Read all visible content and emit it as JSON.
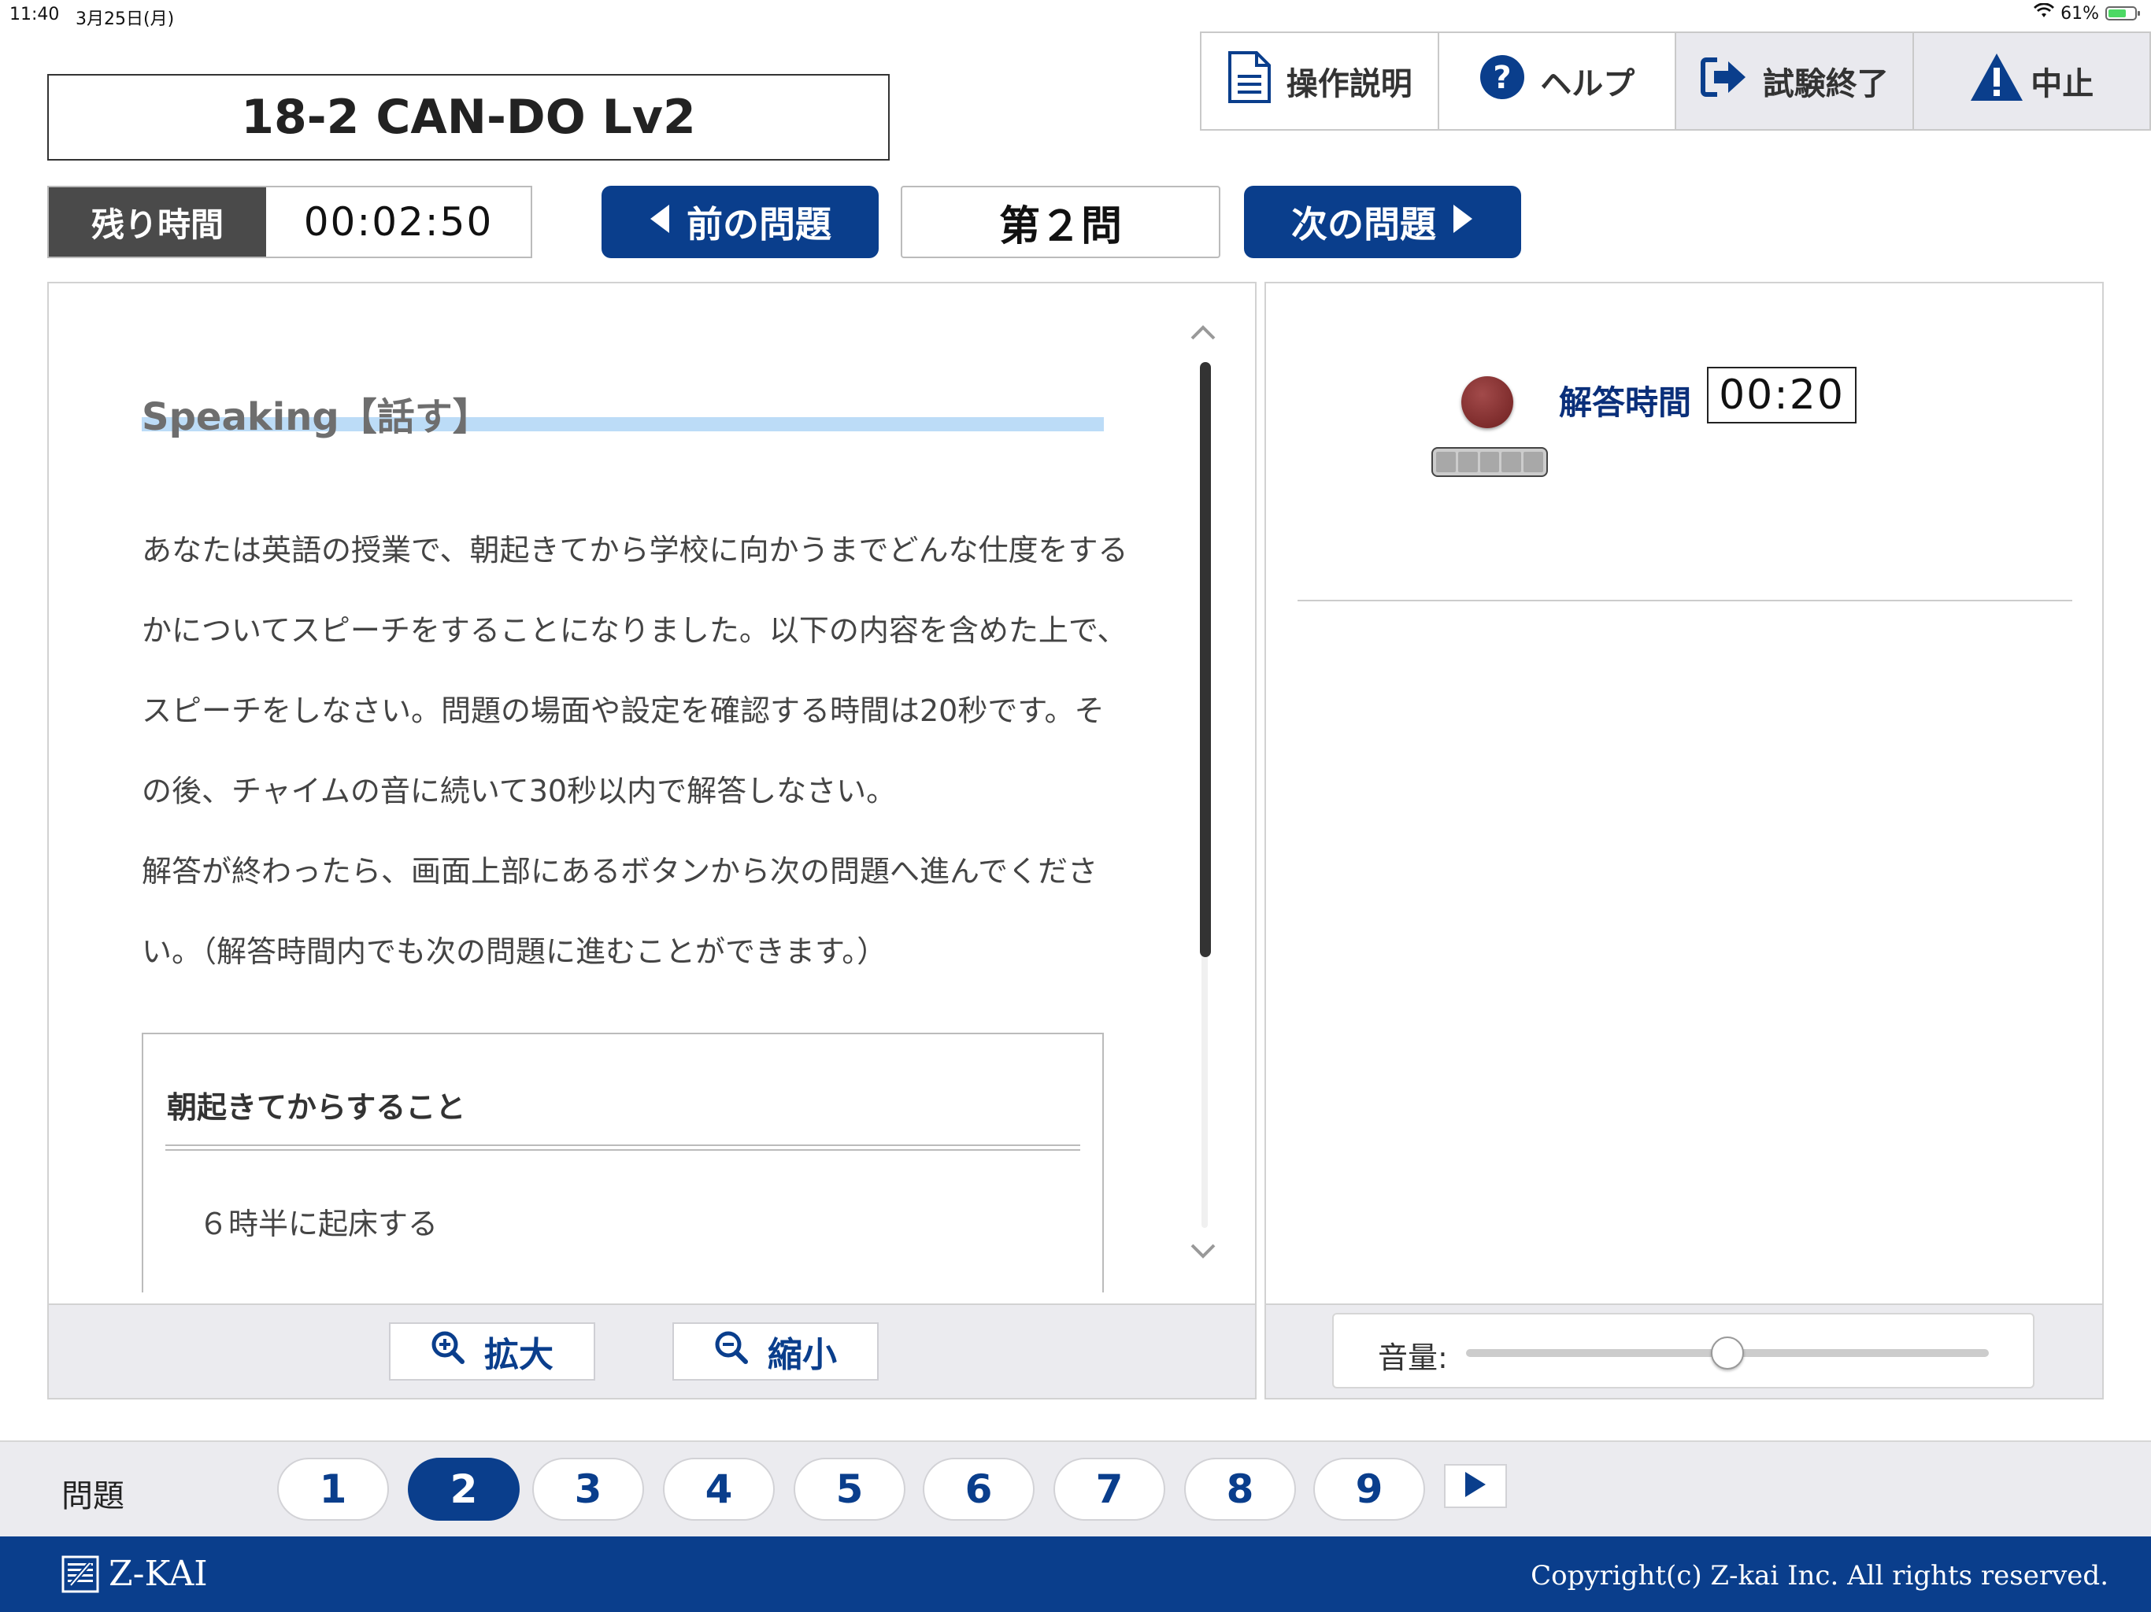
{
  "status_bar": {
    "time": "11:40",
    "date": "3月25日(月)",
    "battery": "61%"
  },
  "exam": {
    "title": "18-2 CAN-DO Lv2"
  },
  "toolbar": {
    "instructions": "操作説明",
    "help": "ヘルプ",
    "end_exam": "試験終了",
    "abort": "中止"
  },
  "timer": {
    "label": "残り時間",
    "value": "00:02:50"
  },
  "navigation": {
    "prev": "前の問題",
    "current": "第２問",
    "next": "次の問題"
  },
  "question": {
    "section_title": "Speaking【話す】",
    "paragraph1": "あなたは英語の授業で、朝起きてから学校に向かうまでどんな仕度をするかについてスピーチをすることになりました。以下の内容を含めた上で、スピーチをしなさい。問題の場面や設定を確認する時間は20秒です。その後、チャイムの音に続いて30秒以内で解答しなさい。",
    "paragraph2": "解答が終わったら、画面上部にあるボタンから次の問題へ進んでください。（解答時間内でも次の問題に進むことができます。）",
    "box_heading": "朝起きてからすること",
    "box_item": "６時半に起床する"
  },
  "zoom": {
    "in": "拡大",
    "out": "縮小"
  },
  "recording": {
    "answer_time_label": "解答時間",
    "answer_time": "00:20"
  },
  "volume": {
    "label": "音量:",
    "level": 0.5
  },
  "question_nav": {
    "label": "問題",
    "items": [
      "1",
      "2",
      "3",
      "4",
      "5",
      "6",
      "7",
      "8",
      "9"
    ],
    "active": "2"
  },
  "footer": {
    "logo": "Z-KAI",
    "copyright": "Copyright(c) Z-kai Inc. All rights reserved."
  },
  "colors": {
    "primary": "#0a3e8c",
    "timer_label_bg": "#4a4a4a",
    "record": "#8b2c2c"
  }
}
